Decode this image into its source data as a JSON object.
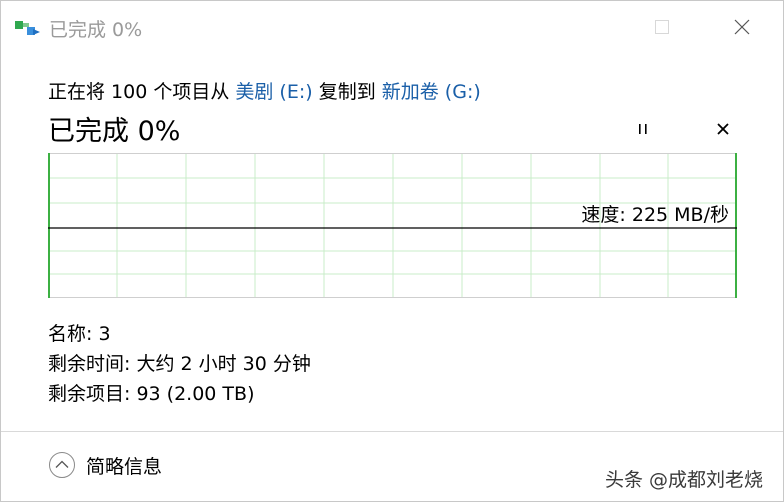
{
  "window": {
    "title": "已完成 0%"
  },
  "header": {
    "copy_prefix": "正在将 100 个项目从 ",
    "source": "美剧 (E:)",
    "copy_middle": " 复制到 ",
    "destination": "新加卷 (G:)",
    "progress_title": "已完成 0%"
  },
  "graph": {
    "speed_text": "速度: 225 MB/秒",
    "progress_fraction": 0.0
  },
  "details": {
    "name_label": "名称:",
    "name_value": "3",
    "time_label": "剩余时间:",
    "time_value": "大约 2 小时 30 分钟",
    "items_label": "剩余项目:",
    "items_value": "93 (2.00 TB)"
  },
  "footer": {
    "fewer_details_label": "简略信息"
  },
  "watermark": {
    "text": "头条 @成都刘老烧"
  },
  "colors": {
    "link": "#1a5fa8",
    "graph_grid": "#c8ecc8",
    "graph_border": "#3cb043"
  }
}
